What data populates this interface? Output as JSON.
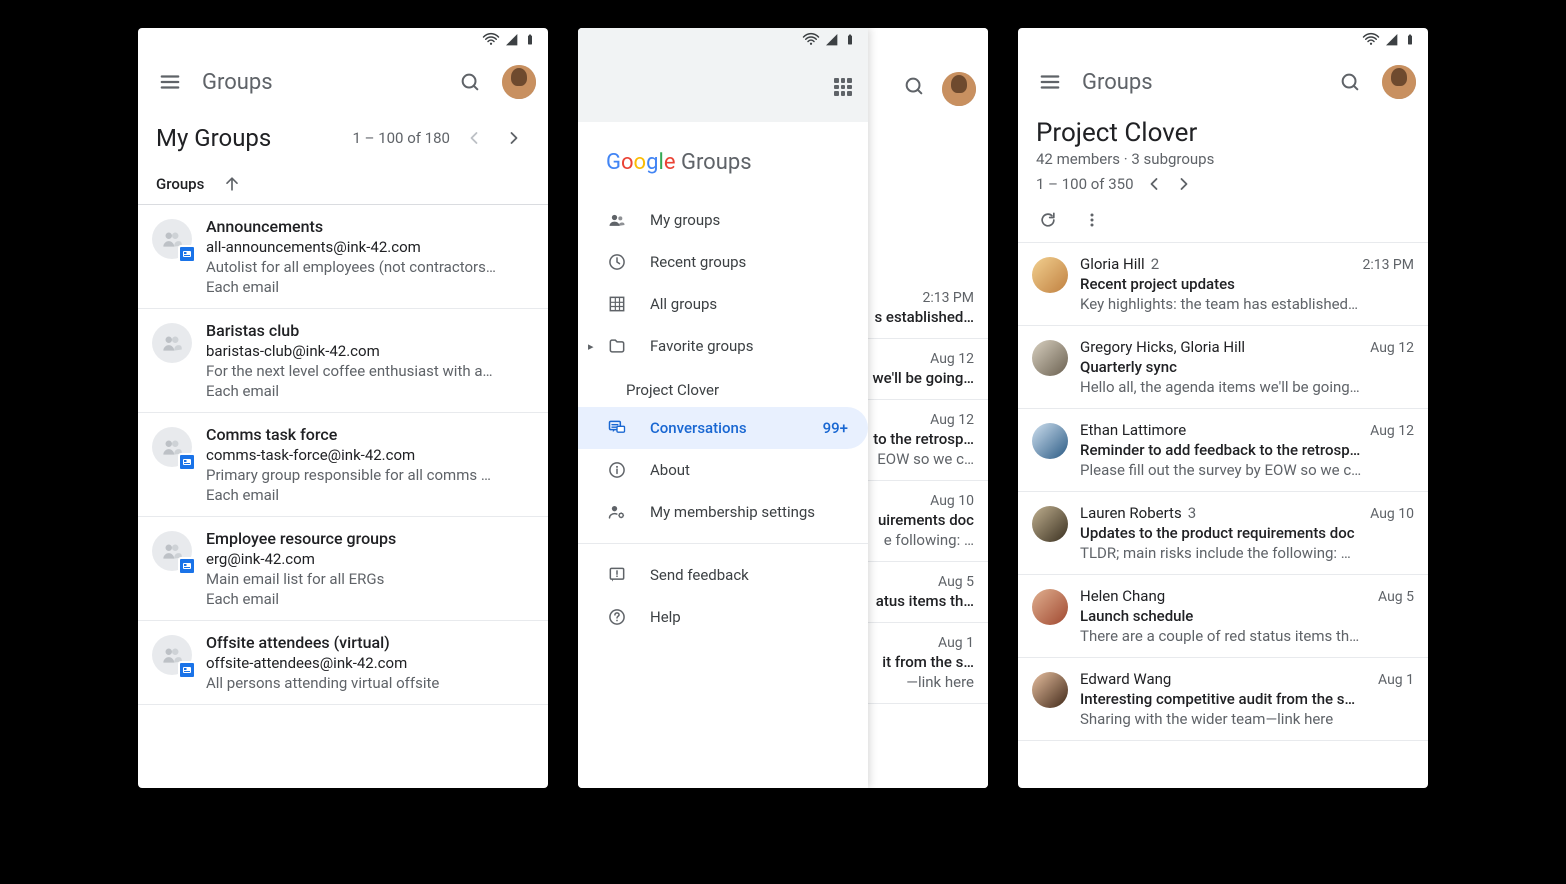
{
  "app_title": "Groups",
  "screen1": {
    "title": "My Groups",
    "range": "1 – 100 of 180",
    "column": "Groups",
    "items": [
      {
        "name": "Announcements",
        "email": "all-announcements@ink-42.com",
        "desc": "Autolist for all employees (not contractors…",
        "sub": "Each email",
        "badge": true
      },
      {
        "name": "Baristas club",
        "email": "baristas-club@ink-42.com",
        "desc": "For the next level coffee enthusiast with a…",
        "sub": "Each email",
        "badge": false
      },
      {
        "name": "Comms task force",
        "email": "comms-task-force@ink-42.com",
        "desc": "Primary group responsible for all comms …",
        "sub": "Each email",
        "badge": true
      },
      {
        "name": "Employee resource groups",
        "email": "erg@ink-42.com",
        "desc": "Main email list for all ERGs",
        "sub": "Each email",
        "badge": true
      },
      {
        "name": "Offsite attendees (virtual)",
        "email": "offsite-attendees@ink-42.com",
        "desc": "All persons attending virtual offsite",
        "sub": "",
        "badge": true
      }
    ]
  },
  "screen2": {
    "logo_word": "Groups",
    "nav": [
      {
        "label": "My groups",
        "icon": "group"
      },
      {
        "label": "Recent groups",
        "icon": "clock"
      },
      {
        "label": "All groups",
        "icon": "grid"
      },
      {
        "label": "Favorite groups",
        "icon": "folder",
        "expandable": true
      }
    ],
    "project_label": "Project Clover",
    "project_nav": [
      {
        "label": "Conversations",
        "icon": "chat",
        "selected": true,
        "count": "99+"
      },
      {
        "label": "About",
        "icon": "info"
      },
      {
        "label": "My membership settings",
        "icon": "person-gear"
      }
    ],
    "footer_nav": [
      {
        "label": "Send feedback",
        "icon": "feedback"
      },
      {
        "label": "Help",
        "icon": "help"
      }
    ],
    "peek": [
      {
        "date": "2:13 PM",
        "snip": "s established…"
      },
      {
        "date": "Aug 12",
        "snip": "we'll be going…"
      },
      {
        "date": "Aug 12",
        "snip": "to the retrosp…",
        "snip2": "EOW so we c…"
      },
      {
        "date": "Aug 10",
        "snip": "uirements doc",
        "snip2": "e following: …"
      },
      {
        "date": "Aug 5",
        "snip": "atus items th…"
      },
      {
        "date": "Aug 1",
        "snip": "it from the s…",
        "snip2": "—link here"
      }
    ]
  },
  "screen3": {
    "title": "Project Clover",
    "meta": "42 members · 3 subgroups",
    "range": "1 – 100 of 350",
    "threads": [
      {
        "authors": "Gloria Hill",
        "count": "2",
        "date": "2:13 PM",
        "subj": "Recent project updates",
        "snip": "Key highlights: the team has established…",
        "av": "av-gloria"
      },
      {
        "authors": "Gregory Hicks, Gloria Hill",
        "count": "",
        "date": "Aug 12",
        "subj": "Quarterly sync",
        "snip": "Hello all, the agenda items we'll be going…",
        "av": "av-gregory"
      },
      {
        "authors": "Ethan Lattimore",
        "count": "",
        "date": "Aug 12",
        "subj": "Reminder to add feedback to the retrosp…",
        "snip": "Please fill out the survey by EOW so we c…",
        "av": "av-ethan"
      },
      {
        "authors": "Lauren Roberts",
        "count": "3",
        "date": "Aug 10",
        "subj": "Updates to the product requirements doc",
        "snip": "TLDR; main risks include the following: …",
        "av": "av-lauren"
      },
      {
        "authors": "Helen Chang",
        "count": "",
        "date": "Aug 5",
        "subj": "Launch schedule",
        "snip": "There are a couple of red status items th…",
        "av": "av-helen"
      },
      {
        "authors": "Edward Wang",
        "count": "",
        "date": "Aug 1",
        "subj": "Interesting competitive audit from the s…",
        "snip": "Sharing with the wider team—link here",
        "av": "av-edward"
      }
    ]
  }
}
